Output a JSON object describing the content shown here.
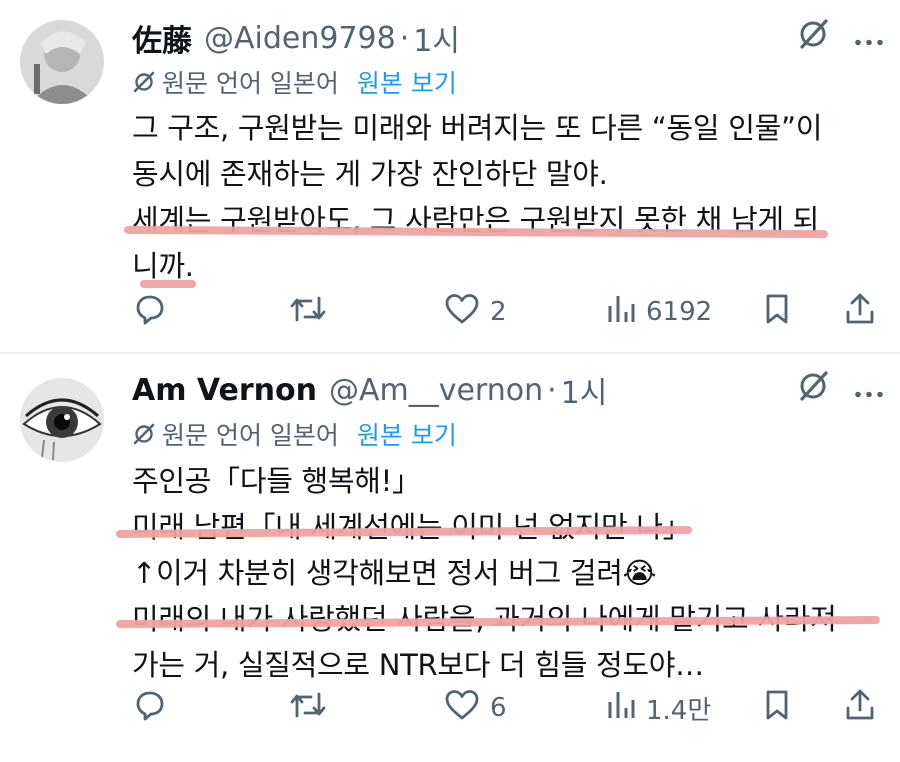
{
  "tweets": [
    {
      "display_name": "佐藤",
      "handle": "@Aiden9798",
      "time": "1시",
      "translate": {
        "original_label": "원문 언어 일본어",
        "show_original": "원본 보기"
      },
      "lines": [
        "그 구조, 구원받는 미래와 버려지는 또 다른 “동일 인물”이",
        "동시에 존재하는 게 가장 잔인하단 말야.",
        "세계는 구원받아도, 그 사람만은 구원받지 못한 채 남게 되",
        "니까."
      ],
      "likes": "2",
      "views": "6192",
      "reposts": "",
      "replies": ""
    },
    {
      "display_name": "Am Vernon",
      "handle": "@Am__vernon",
      "time": "1시",
      "translate": {
        "original_label": "원문 언어 일본어",
        "show_original": "원본 보기"
      },
      "lines": [
        "주인공「다들 행복해!」",
        "미래 남편「내 세계선에는 이미 넌 없지만 나」",
        "↑이거 차분히 생각해보면 정서 버그 걸려😭",
        "미래의 내가 사랑했던 사람을, 과거의 나에게 맡기고 사라져",
        "가는 거, 실질적으로 NTR보다 더 힘들 정도야…"
      ],
      "likes": "6",
      "views": "1.4만",
      "reposts": "",
      "replies": ""
    }
  ],
  "separator": "·",
  "colors": {
    "text": "#0f1419",
    "secondary": "#536471",
    "link": "#1d9bf0",
    "highlight_underline": "#f0a2a2",
    "divider": "#eff3f4"
  },
  "icons": [
    "grok-icon",
    "more-icon",
    "translate-icon",
    "reply-icon",
    "repost-icon",
    "like-icon",
    "views-icon",
    "bookmark-icon",
    "share-icon"
  ]
}
